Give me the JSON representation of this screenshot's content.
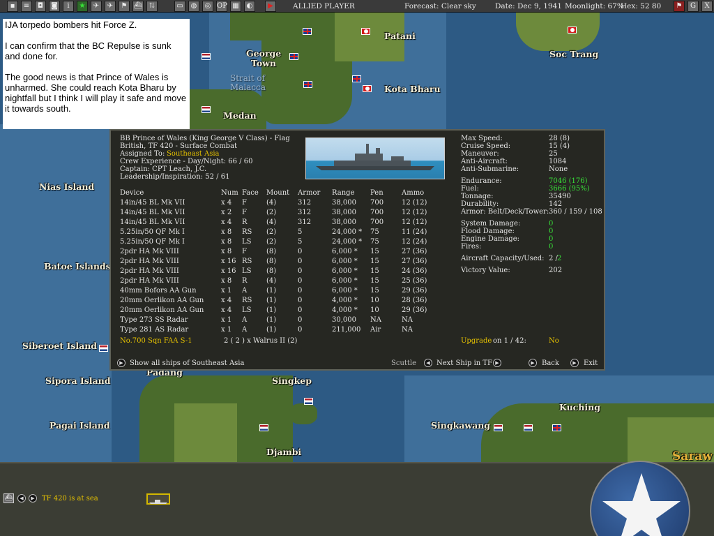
{
  "toolbar": {
    "side": "ALLIED PLAYER",
    "forecast": "Forecast: Clear sky",
    "date": "Date: Dec 9, 1941",
    "moonlight": "Moonlight: 67%",
    "hex": "Hex: 52 80",
    "btn_g": "G",
    "btn_x": "X"
  },
  "note": {
    "p1": "IJA torpedo bombers hit Force Z.",
    "p2": "I can confirm that the BC Repulse is sunk and done for.",
    "p3": "The good news is that Prince of Wales is unharmed. She could reach Kota Bharu by nightfall but I think I will play it safe and move it towards south."
  },
  "map": {
    "cities": [
      "Patani",
      "George Town",
      "Soc Trang",
      "Kota Bharu",
      "Medan",
      "Padang",
      "Singkep",
      "Kuching",
      "Singkawang",
      "Djambi",
      "Saraw"
    ],
    "seas": [
      "Strait of Malacca"
    ],
    "islands": [
      "Nias Island",
      "Batoe Islands",
      "Siberoet Island",
      "Sipora Island",
      "Pagai Island"
    ]
  },
  "ship": {
    "header": {
      "name_line": "BB Prince of Wales (King George V Class) - Flag",
      "tf_line": "British, TF 420 - Surface Combat",
      "assigned_label": "Assigned To:",
      "assigned_value": "Southeast Asia",
      "crew": "Crew Experience - Day/Night: 66 / 60",
      "captain": "Captain: CPT Leach, J.C.",
      "leadership": "Leadership/Inspiration: 52 / 61"
    },
    "columns": [
      "Device",
      "Num",
      "Face",
      "Mount",
      "Armor",
      "Range",
      "Pen",
      "Ammo"
    ],
    "devices": [
      [
        "14in/45 BL Mk VII",
        "x 4",
        "F",
        "(4)",
        "312",
        "38,000",
        "700",
        "12   (12)"
      ],
      [
        "14in/45 BL Mk VII",
        "x 2",
        "F",
        "(2)",
        "312",
        "38,000",
        "700",
        "12   (12)"
      ],
      [
        "14in/45 BL Mk VII",
        "x 4",
        "R",
        "(4)",
        "312",
        "38,000",
        "700",
        "12   (12)"
      ],
      [
        "5.25in/50 QF Mk I",
        "x 8",
        "RS",
        "(2)",
        "5",
        "24,000 *",
        "75",
        "11   (24)"
      ],
      [
        "5.25in/50 QF Mk I",
        "x 8",
        "LS",
        "(2)",
        "5",
        "24,000 *",
        "75",
        "12   (24)"
      ],
      [
        "2pdr HA Mk VIII",
        "x 8",
        "F",
        "(8)",
        "0",
        "6,000 *",
        "15",
        "27   (36)"
      ],
      [
        "2pdr HA Mk VIII",
        "x 16",
        "RS",
        "(8)",
        "0",
        "6,000 *",
        "15",
        "27   (36)"
      ],
      [
        "2pdr HA Mk VIII",
        "x 16",
        "LS",
        "(8)",
        "0",
        "6,000 *",
        "15",
        "24   (36)"
      ],
      [
        "2pdr HA Mk VIII",
        "x 8",
        "R",
        "(4)",
        "0",
        "6,000 *",
        "15",
        "25   (36)"
      ],
      [
        "40mm Bofors AA Gun",
        "x 1",
        "A",
        "(1)",
        "0",
        "6,000 *",
        "15",
        "29   (36)"
      ],
      [
        "20mm Oerlikon AA Gun",
        "x 4",
        "RS",
        "(1)",
        "0",
        "4,000 *",
        "10",
        "28   (36)"
      ],
      [
        "20mm Oerlikon AA Gun",
        "x 4",
        "LS",
        "(1)",
        "0",
        "4,000 *",
        "10",
        "29   (36)"
      ],
      [
        "Type 273 SS Radar",
        "x 1",
        "A",
        "(1)",
        "0",
        "30,000",
        "NA",
        "NA"
      ],
      [
        "Type 281 AS Radar",
        "x 1",
        "A",
        "(1)",
        "0",
        "211,000",
        "Air",
        "NA"
      ]
    ],
    "stats": {
      "max_speed_label": "Max Speed:",
      "max_speed": "28 (8)",
      "cruise_speed_label": "Cruise Speed:",
      "cruise_speed": "15 (4)",
      "maneuver_label": "Maneuver:",
      "maneuver": "25",
      "aa_label": "Anti-Aircraft:",
      "aa": "1084",
      "asub_label": "Anti-Submarine:",
      "asub": "None",
      "endurance_label": "Endurance:",
      "endurance": "7046 (176)",
      "fuel_label": "Fuel:",
      "fuel": "3666 (95%)",
      "tonnage_label": "Tonnage:",
      "tonnage": "35490",
      "durability_label": "Durability:",
      "durability": "142",
      "armor_label": "Armor: Belt/Deck/Tower:",
      "armor": "360 / 159 / 108",
      "sys_dmg_label": "System Damage:",
      "sys_dmg": "0",
      "flood_dmg_label": "Flood Damage:",
      "flood_dmg": "0",
      "engine_dmg_label": "Engine Damage:",
      "engine_dmg": "0",
      "fires_label": "Fires:",
      "fires": "0",
      "aircraft_label": "Aircraft Capacity/Used:",
      "aircraft_cap": "2 /",
      "aircraft_used": "2",
      "victory_label": "Victory Value:",
      "victory": "202"
    },
    "air_unit": "No.700 Sqn FAA S-1",
    "air_unit_detail": "2 ( 2 ) x Walrus II (2)",
    "upgrade_label": "Upgrade",
    "upgrade_on": "on 1 / 42:",
    "upgrade_value": "No",
    "show_all": "Show all ships of Southeast Asia",
    "scuttle": "Scuttle",
    "next_ship": "Next Ship in TF",
    "back": "Back",
    "exit": "Exit"
  },
  "bottom": {
    "status": "TF 420 is at sea"
  },
  "colors": {
    "accent_yellow": "#e6c200",
    "green_value": "#38e038",
    "panel": "#262722"
  }
}
